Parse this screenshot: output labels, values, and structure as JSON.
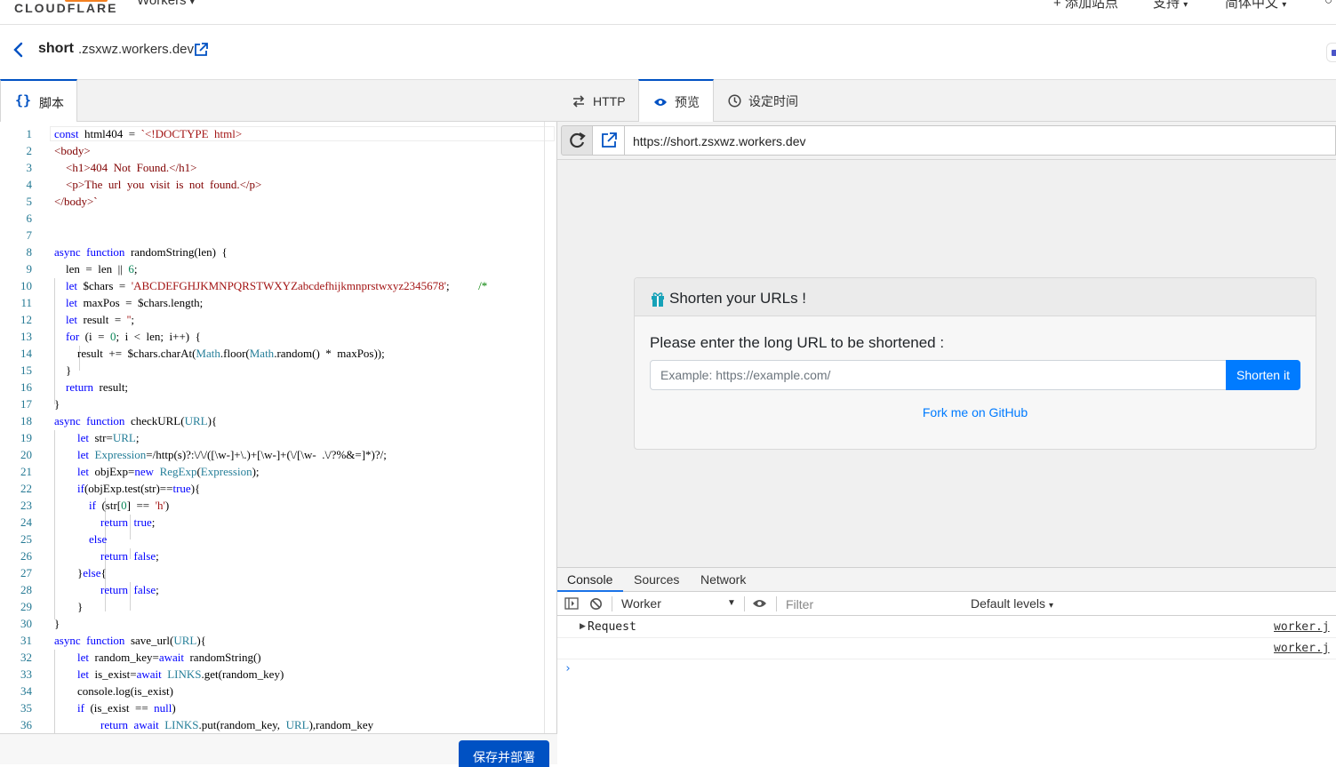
{
  "topnav": {
    "logo": "CLOUDFLARE",
    "product": "Workers",
    "add_site": "添加站点",
    "support": "支持",
    "language": "简体中文"
  },
  "subheader": {
    "worker_name": "short",
    "domain": ".zsxwz.workers.dev"
  },
  "editor": {
    "tab_label": "脚本",
    "deploy_label": "保存并部署",
    "line_numbers": [
      "1",
      "2",
      "3",
      "4",
      "5",
      "6",
      "7",
      "8",
      "9",
      "10",
      "11",
      "12",
      "13",
      "14",
      "15",
      "16",
      "17",
      "18",
      "19",
      "20",
      "21",
      "22",
      "23",
      "24",
      "25",
      "26",
      "27",
      "28",
      "29",
      "30",
      "31",
      "32",
      "33",
      "34",
      "35",
      "36"
    ],
    "lines": [
      "const  html404  =  `<!DOCTYPE  html>",
      "<body>",
      "    <h1>404  Not  Found.</h1>",
      "    <p>The  url  you  visit  is  not  found.</p>",
      "</body>`",
      "",
      "",
      "async  function  randomString(len)  {",
      "    len  =  len  ||  6;",
      "    let  $chars  =  'ABCDEFGHJKMNPQRSTWXYZabcdefhijkmnprstwxyz2345678';          /*",
      "    let  maxPos  =  $chars.length;",
      "    let  result  =  '';",
      "    for  (i  =  0;  i  <  len;  i++)  {",
      "        result  +=  $chars.charAt(Math.floor(Math.random()  *  maxPos));",
      "    }",
      "    return  result;",
      "}",
      "async  function  checkURL(URL){",
      "        let  str=URL;",
      "        let  Expression=/http(s)?:\\/\\/([\\w-]+\\.)+[\\w-]+(\\/[\\w-  .\\/?%&=]*)?/;",
      "        let  objExp=new  RegExp(Expression);",
      "        if(objExp.test(str)==true){",
      "            if  (str[0]  ==  'h')",
      "                return  true;",
      "            else",
      "                return  false;",
      "        }else{",
      "                return  false;",
      "        }",
      "}",
      "async  function  save_url(URL){",
      "        let  random_key=await  randomString()",
      "        let  is_exist=await  LINKS.get(random_key)",
      "        console.log(is_exist)",
      "        if  (is_exist  ==  null)",
      "                return  await  LINKS.put(random_key,  URL),random_key"
    ]
  },
  "preview_tabs": [
    "HTTP",
    "预览",
    "设定时间"
  ],
  "url_bar": {
    "url": "https://short.zsxwz.workers.dev"
  },
  "page": {
    "title": "Shorten your URLs !",
    "prompt": "Please enter the long URL to be shortened :",
    "placeholder": "Example: https://example.com/",
    "button": "Shorten it",
    "fork": "Fork me on GitHub"
  },
  "devtools": {
    "tabs": [
      "Console",
      "Sources",
      "Network"
    ],
    "context": "Worker",
    "filter_placeholder": "Filter",
    "levels": "Default levels",
    "rows": [
      {
        "text": "Request",
        "source": "worker.j"
      },
      {
        "text": "",
        "source": "worker.j"
      }
    ],
    "prompt": "›"
  },
  "colors": {
    "accent": "#0051c3",
    "cloudflare_orange": "#f38020",
    "bootstrap_primary": "#007bff",
    "devtools_blue": "#1a73e8"
  },
  "icons": [
    "chevron-left-icon",
    "external-link-icon",
    "braces-icon",
    "swap-arrows-icon",
    "eye-icon",
    "clock-icon",
    "reload-icon",
    "gift-icon",
    "dock-icon",
    "clear-icon",
    "eye-live-icon",
    "caret-down-icon"
  ]
}
